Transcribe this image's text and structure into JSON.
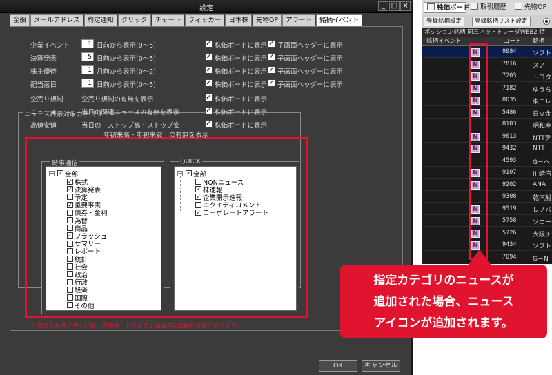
{
  "dialog": {
    "title": "設定",
    "tabs": [
      "全般",
      "メールアドレス",
      "約定通知",
      "クリック",
      "チャート",
      "ティッカー",
      "日本株",
      "先物OP",
      "アラート",
      "銘柄イベント"
    ],
    "active_tab_index": 9,
    "event_rows": [
      {
        "label": "企業イベント",
        "value": "1",
        "suffix": "日前から表示(0〜5)",
        "board_label": "株価ボードに表示",
        "board_checked": true,
        "sub_label": "子画面ヘッダーに表示",
        "sub_checked": true
      },
      {
        "label": "決算発表",
        "value": "5",
        "suffix": "日前から表示(0〜5)",
        "board_label": "株価ボードに表示",
        "board_checked": true,
        "sub_label": "子画面ヘッダーに表示",
        "sub_checked": true
      },
      {
        "label": "株主優待",
        "value": "1",
        "suffix": "月前から表示(0〜2)",
        "board_label": "株価ボードに表示",
        "board_checked": true,
        "sub_label": "子画面ヘッダーに表示",
        "sub_checked": true
      },
      {
        "label": "配当落日",
        "value": "1",
        "suffix": "日前から表示(0〜5)",
        "board_label": "株価ボードに表示",
        "board_checked": true,
        "sub_label": "子画面ヘッダーに表示",
        "sub_checked": true
      }
    ],
    "other_rows": [
      {
        "label": "空売り規制",
        "desc": "空売り規制の有無を表示",
        "board_label": "株価ボードに表示",
        "board_checked": true
      },
      {
        "label": "ニュース",
        "desc": "当日の関連ニュースの有無を表示",
        "board_label": "株価ボードに表示",
        "board_checked": true
      },
      {
        "label": "高値安値",
        "desc": "当日の　ストップ高・ストップ安",
        "board_label": "株価ボードに表示",
        "board_checked": true
      }
    ],
    "high_low_line2": "年初来高・年初来安　の有無を表示",
    "news_group_title": "ニュース表示対象カテゴリ",
    "jiji": {
      "title": "時事通信",
      "root": "全部",
      "items": [
        {
          "label": "株式",
          "checked": true
        },
        {
          "label": "決算発表",
          "checked": true
        },
        {
          "label": "予定",
          "checked": false
        },
        {
          "label": "重要事実",
          "checked": true
        },
        {
          "label": "債券・金利",
          "checked": false
        },
        {
          "label": "為替",
          "checked": false
        },
        {
          "label": "商品",
          "checked": false
        },
        {
          "label": "フラッシュ",
          "checked": true
        },
        {
          "label": "サマリー",
          "checked": false
        },
        {
          "label": "レポート",
          "checked": false
        },
        {
          "label": "統計",
          "checked": false
        },
        {
          "label": "社会",
          "checked": false
        },
        {
          "label": "政治",
          "checked": false
        },
        {
          "label": "行政",
          "checked": false
        },
        {
          "label": "経済",
          "checked": false
        },
        {
          "label": "国際",
          "checked": false
        },
        {
          "label": "その他",
          "checked": false
        }
      ]
    },
    "quick": {
      "title": "QUICK",
      "root": "全部",
      "items": [
        {
          "label": "NQNニュース",
          "checked": false
        },
        {
          "label": "株速報",
          "checked": true
        },
        {
          "label": "企業開示速報",
          "checked": true
        },
        {
          "label": "エクイティコメント",
          "checked": false
        },
        {
          "label": "コーポレートアラート",
          "checked": true
        }
      ]
    },
    "note": "※ 設定を反映させるには、株価ボードおよび子画面の再起動が必要になります。",
    "ok_label": "OK",
    "cancel_label": "キャンセル"
  },
  "board": {
    "tabs": {
      "board": "株価ボード",
      "history": "取引履歴",
      "option": "先物OP"
    },
    "btn_register": "登録銘柄設定",
    "btn_list": "登録銘柄リスト設定",
    "portfolio": "ポジション銘柄  同三ネットトレーダWEB2  特",
    "headers": {
      "event": "銘柄イベント",
      "code": "コード",
      "name": "銘柄"
    },
    "news_icon_label": "N",
    "rows": [
      {
        "code": "9984",
        "name": "ソフト",
        "news": true,
        "selected": true
      },
      {
        "code": "7816",
        "name": "スノー",
        "news": true,
        "selected": false
      },
      {
        "code": "7203",
        "name": "トヨタ",
        "news": true,
        "selected": false
      },
      {
        "code": "7182",
        "name": "ゆうち",
        "news": true,
        "selected": false
      },
      {
        "code": "8035",
        "name": "東エレ",
        "news": true,
        "selected": false
      },
      {
        "code": "5486",
        "name": "日立金",
        "news": true,
        "selected": false
      },
      {
        "code": "8103",
        "name": "明和産",
        "news": false,
        "selected": false
      },
      {
        "code": "9613",
        "name": "NTTテ",
        "news": true,
        "selected": false
      },
      {
        "code": "9432",
        "name": "NTT",
        "news": true,
        "selected": false
      },
      {
        "code": "4593",
        "name": "G－ヘ",
        "news": false,
        "selected": false
      },
      {
        "code": "9107",
        "name": "川崎汽",
        "news": true,
        "selected": false
      },
      {
        "code": "9202",
        "name": "ANA",
        "news": true,
        "selected": false
      },
      {
        "code": "9308",
        "name": "乾汽船",
        "news": false,
        "selected": false
      },
      {
        "code": "9519",
        "name": "レノバ",
        "news": true,
        "selected": false
      },
      {
        "code": "5758",
        "name": "ソニー",
        "news": true,
        "selected": false
      },
      {
        "code": "5726",
        "name": "大阪チ",
        "news": true,
        "selected": false
      },
      {
        "code": "9434",
        "name": "ソフト",
        "news": true,
        "selected": false
      },
      {
        "code": "7094",
        "name": "G－N",
        "news": false,
        "selected": false
      }
    ]
  },
  "callout": {
    "line1": "指定カテゴリのニュースが",
    "line2": "追加された場合、ニュース",
    "line3": "アイコンが追加されます。"
  },
  "colors": {
    "accent_red": "#e0142e",
    "dialog_bg": "#3b3b3b",
    "board_selected": "#0a1e4e",
    "news_icon": "#c9a6c9"
  }
}
